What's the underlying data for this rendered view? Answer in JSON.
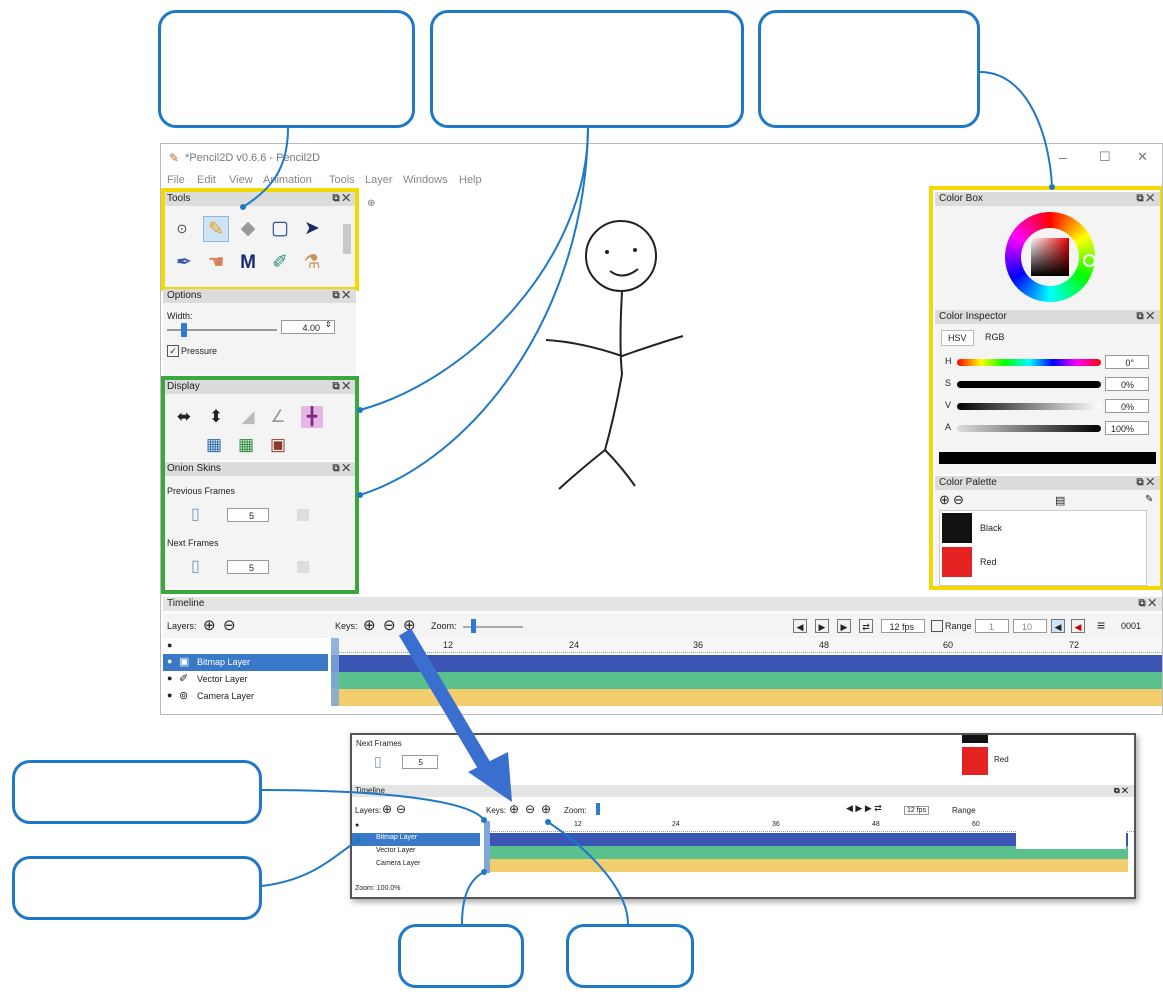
{
  "window": {
    "title": "*Pencil2D v0.6.6 - Pencil2D",
    "controls": [
      "–",
      "☐",
      "✕"
    ]
  },
  "menu": [
    "File",
    "Edit",
    "View",
    "Animation",
    "Tools",
    "Layer",
    "Windows",
    "Help"
  ],
  "tools_panel": {
    "title": "Tools",
    "icons": [
      "camera-icon",
      "pencil-icon",
      "eraser-icon",
      "select-icon",
      "move-icon",
      "eyedropper-icon",
      "smudge-icon",
      "polyline-icon",
      "brush-icon",
      "bucket-icon"
    ]
  },
  "options_panel": {
    "title": "Options",
    "width_label": "Width:",
    "width_value": "4.00",
    "pressure_label": "Pressure"
  },
  "display_panel": {
    "title": "Display"
  },
  "onion_panel": {
    "title": "Onion Skins",
    "previous_label": "Previous Frames",
    "previous_value": "5",
    "next_label": "Next Frames",
    "next_value": "5"
  },
  "color_box": {
    "title": "Color Box"
  },
  "color_inspector": {
    "title": "Color Inspector",
    "tabs": [
      "HSV",
      "RGB"
    ],
    "sliders": [
      {
        "label": "H",
        "value": "0°"
      },
      {
        "label": "S",
        "value": "0%"
      },
      {
        "label": "V",
        "value": "0%"
      },
      {
        "label": "A",
        "value": "100%"
      }
    ],
    "current_color": "#000000"
  },
  "color_palette": {
    "title": "Color Palette",
    "colors": [
      {
        "name": "Black",
        "hex": "#111111"
      },
      {
        "name": "Red",
        "hex": "#e52222"
      }
    ]
  },
  "timeline": {
    "title": "Timeline",
    "layers_label": "Layers:",
    "keys_label": "Keys:",
    "zoom_label": "Zoom:",
    "fps": "12 fps",
    "range_label": "Range",
    "range_start": "1",
    "range_end": "10",
    "frame_counter": "0001",
    "ruler_ticks": [
      "12",
      "24",
      "36",
      "48",
      "60",
      "72"
    ],
    "layers": [
      {
        "name": "Bitmap Layer",
        "color": "#3a55b4"
      },
      {
        "name": "Vector Layer",
        "color": "#5ac18e"
      },
      {
        "name": "Camera Layer",
        "color": "#f2cd6e"
      }
    ]
  },
  "inset": {
    "next_frames_label": "Next Frames",
    "next_frames_value": "5",
    "red_label": "Red",
    "timeline_title": "Timeline",
    "layers_label": "Layers:",
    "keys_label": "Keys:",
    "zoom_label": "Zoom:",
    "fps": "12 fps",
    "range_label": "Range",
    "ruler_ticks": [
      "12",
      "24",
      "36",
      "48",
      "60"
    ],
    "status": "Zoom: 100.0%"
  },
  "colors": {
    "highlight_yellow": "#f5d800",
    "highlight_green": "#3aa83a",
    "callout_blue": "#1e78c8",
    "arrow_blue": "#3a6fd0"
  }
}
